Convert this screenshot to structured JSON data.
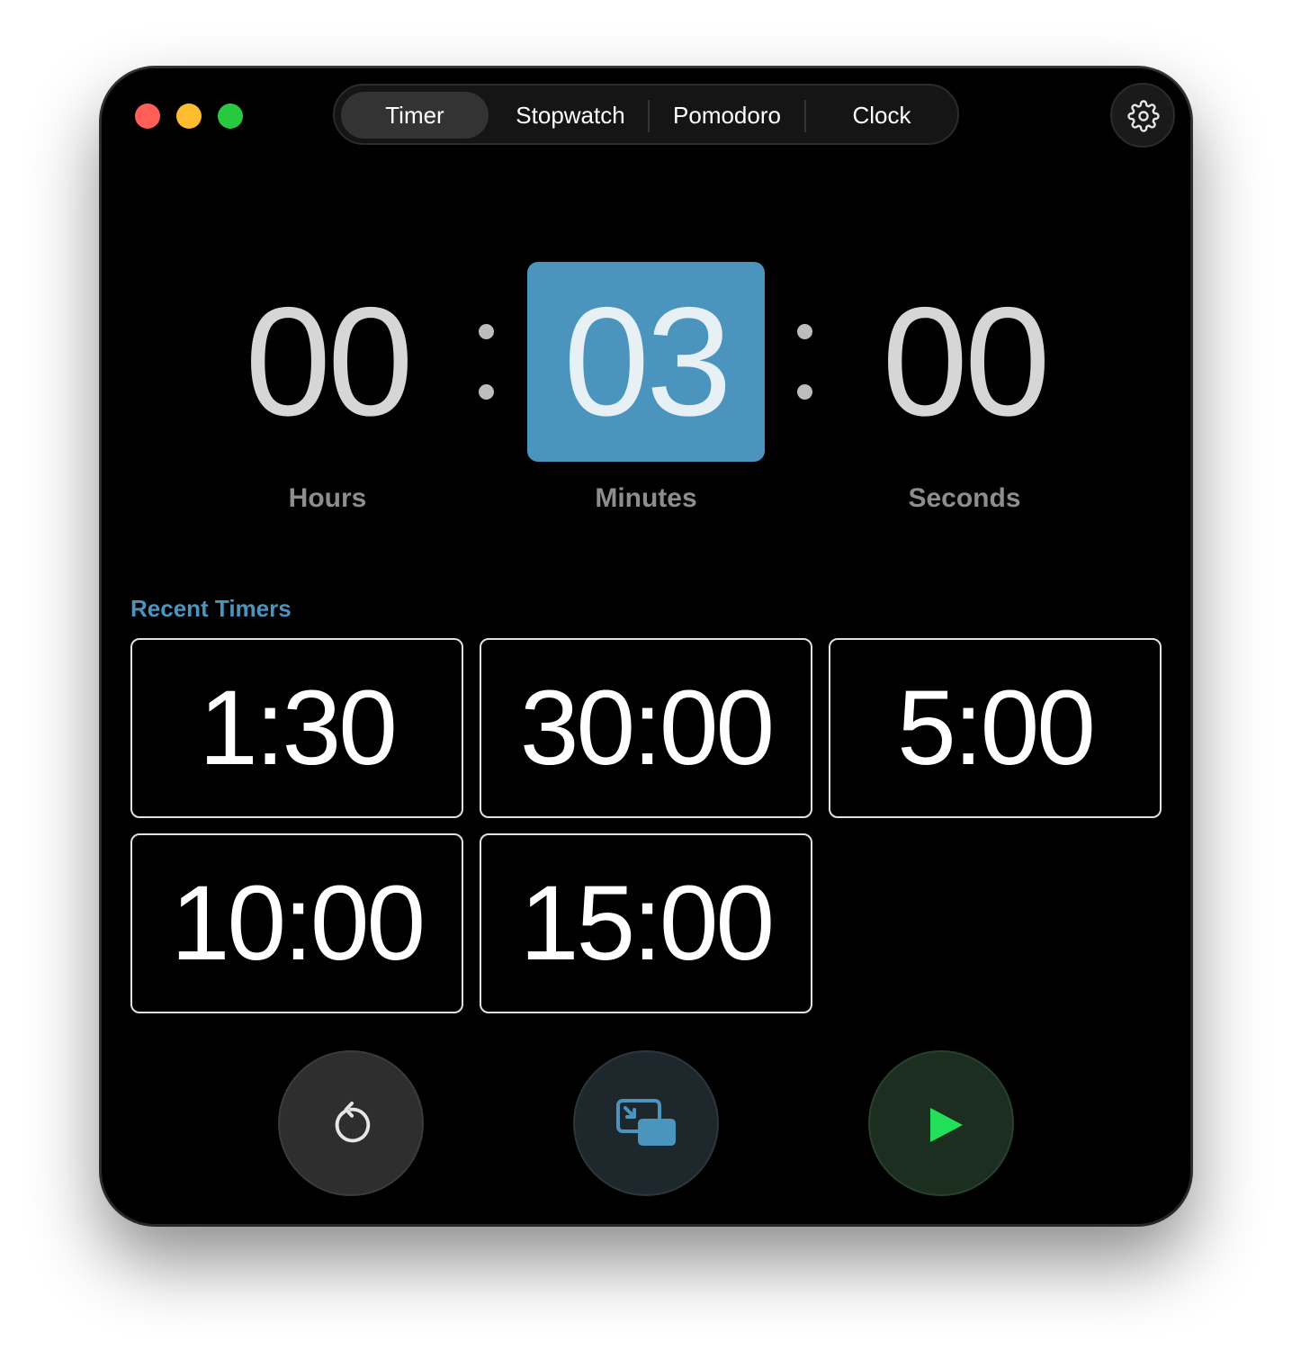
{
  "window": {
    "traffic_lights": {
      "close": "#ff5f57",
      "minimize": "#febc2e",
      "maximize": "#28c840"
    }
  },
  "tabs": [
    {
      "label": "Timer",
      "active": true
    },
    {
      "label": "Stopwatch",
      "active": false
    },
    {
      "label": "Pomodoro",
      "active": false
    },
    {
      "label": "Clock",
      "active": false
    }
  ],
  "settings": {
    "icon": "gear-icon"
  },
  "timer": {
    "hours": "00",
    "minutes": "03",
    "seconds": "00",
    "hours_label": "Hours",
    "minutes_label": "Minutes",
    "seconds_label": "Seconds",
    "selected_field": "minutes"
  },
  "recent": {
    "title": "Recent Timers",
    "items": [
      "1:30",
      "30:00",
      "5:00",
      "10:00",
      "15:00"
    ]
  },
  "controls": {
    "reset_icon": "reset-icon",
    "pip_icon": "picture-in-picture-icon",
    "play_icon": "play-icon"
  },
  "colors": {
    "accent": "#4a94bd",
    "play": "#22e05a",
    "background": "#000000"
  }
}
